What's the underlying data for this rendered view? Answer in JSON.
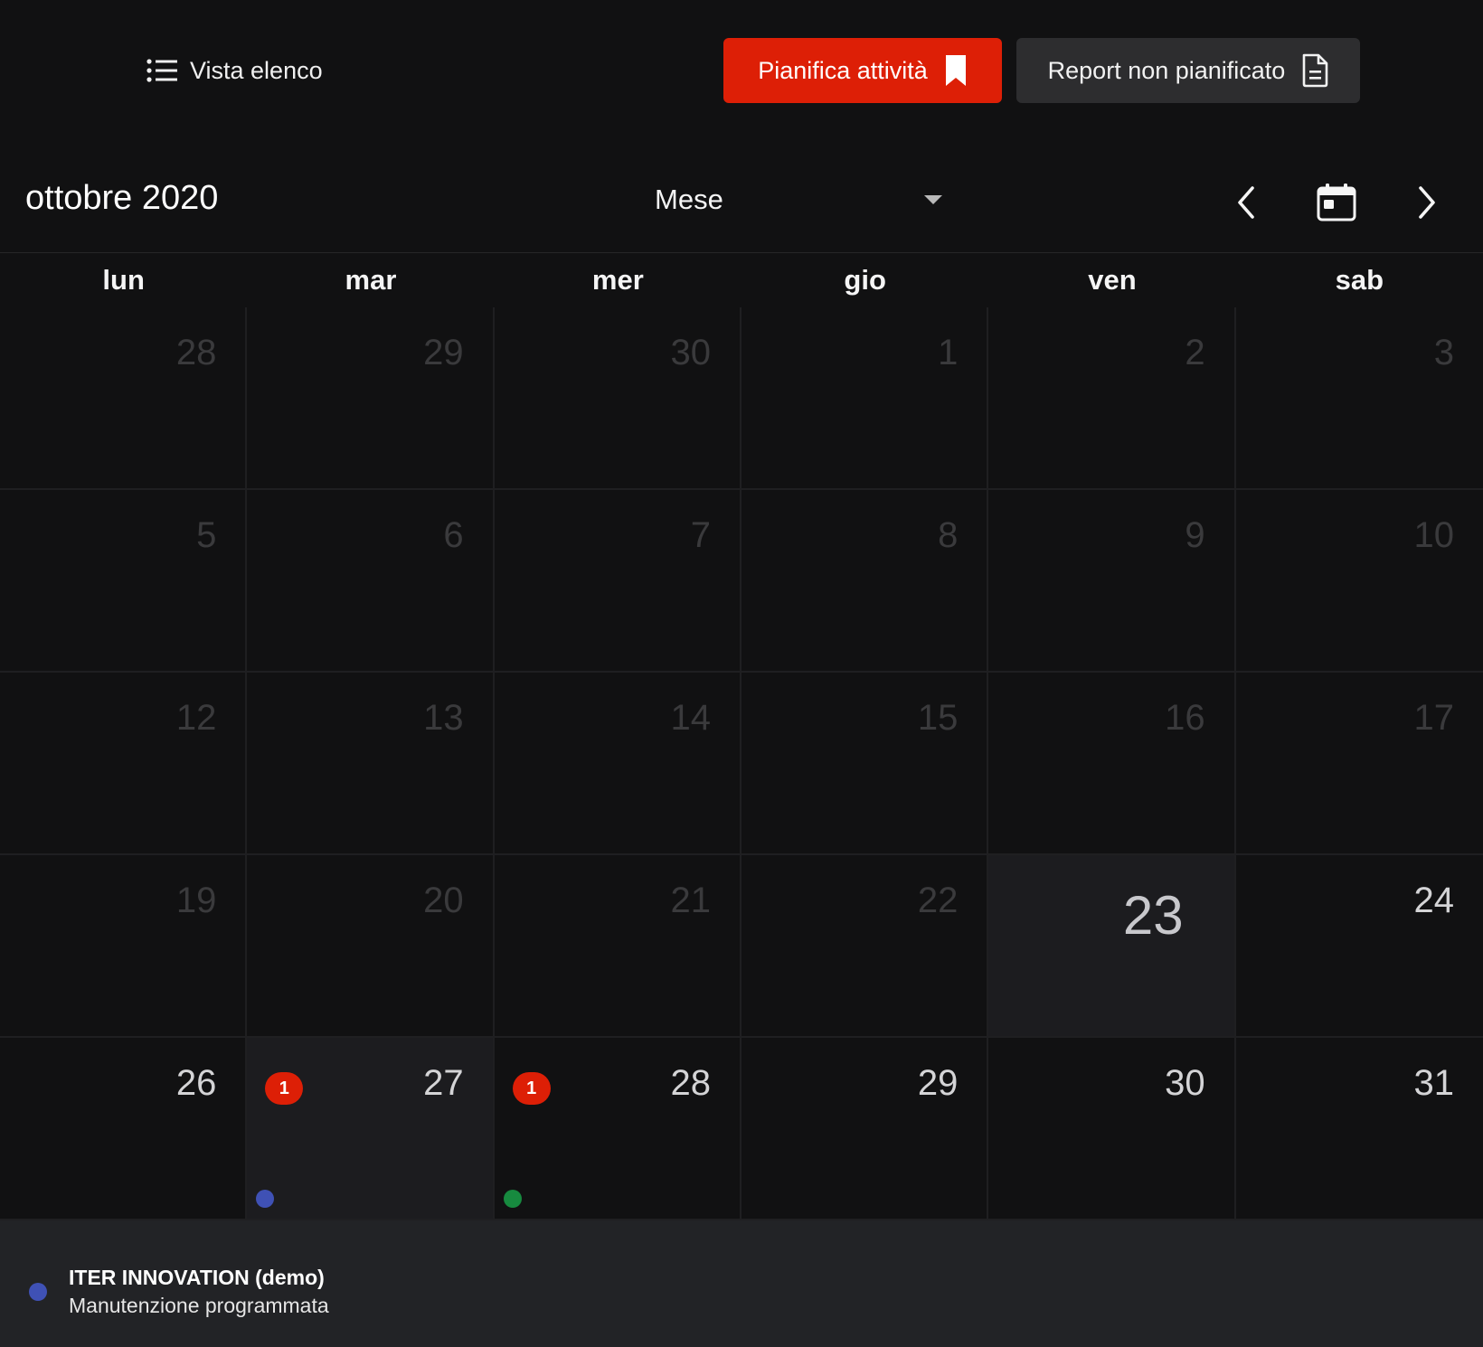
{
  "header": {
    "list_view_label": "Vista elenco",
    "plan_button_label": "Pianifica attività",
    "report_button_label": "Report non pianificato"
  },
  "toolbar": {
    "month_title": "ottobre 2020",
    "view_selected": "Mese"
  },
  "weekdays": [
    "lun",
    "mar",
    "mer",
    "gio",
    "ven",
    "sab"
  ],
  "days": [
    {
      "label": "28",
      "current": false
    },
    {
      "label": "29",
      "current": false
    },
    {
      "label": "30",
      "current": false
    },
    {
      "label": "1",
      "current": false
    },
    {
      "label": "2",
      "current": false
    },
    {
      "label": "3",
      "current": false
    },
    {
      "label": "5",
      "current": false
    },
    {
      "label": "6",
      "current": false
    },
    {
      "label": "7",
      "current": false
    },
    {
      "label": "8",
      "current": false
    },
    {
      "label": "9",
      "current": false
    },
    {
      "label": "10",
      "current": false
    },
    {
      "label": "12",
      "current": false
    },
    {
      "label": "13",
      "current": false
    },
    {
      "label": "14",
      "current": false
    },
    {
      "label": "15",
      "current": false
    },
    {
      "label": "16",
      "current": false
    },
    {
      "label": "17",
      "current": false
    },
    {
      "label": "19",
      "current": false
    },
    {
      "label": "20",
      "current": false
    },
    {
      "label": "21",
      "current": false
    },
    {
      "label": "22",
      "current": false
    },
    {
      "label": "23",
      "current": true,
      "today": true
    },
    {
      "label": "24",
      "current": true
    },
    {
      "label": "26",
      "current": true
    },
    {
      "label": "27",
      "current": true,
      "selected": true,
      "badge": "1",
      "dot_color": "#3f51b5"
    },
    {
      "label": "28",
      "current": true,
      "badge": "1",
      "dot_color": "#178a3f"
    },
    {
      "label": "29",
      "current": true
    },
    {
      "label": "30",
      "current": true
    },
    {
      "label": "31",
      "current": true
    }
  ],
  "event": {
    "title": "ITER INNOVATION (demo)",
    "subtitle": "Manutenzione programmata",
    "dot_color": "#3f51b5"
  },
  "colors": {
    "accent": "#dd1f06",
    "background": "#111112"
  }
}
